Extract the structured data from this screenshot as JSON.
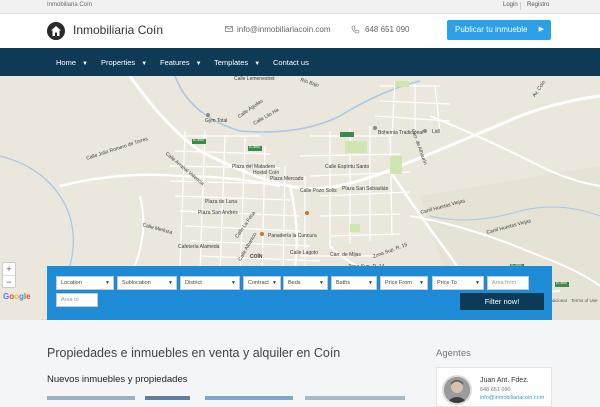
{
  "topbar": {
    "site_name": "Inmobiliaria Coín",
    "login": "Login",
    "register": "Registro"
  },
  "header": {
    "logo_text": "Inmobiliaria Coín",
    "logo_icon": "house-icon",
    "email": "info@inmobiliariacoin.com",
    "phone": "648 651 090",
    "publish_button": "Publicar tu inmueble",
    "accent": "#2b9fe8"
  },
  "nav": {
    "background": "#0e3a56",
    "items": [
      {
        "label": "Home",
        "dropdown": true
      },
      {
        "label": "Properties",
        "dropdown": true
      },
      {
        "label": "Features",
        "dropdown": true
      },
      {
        "label": "Templates",
        "dropdown": true
      },
      {
        "label": "Contact us",
        "dropdown": false
      }
    ]
  },
  "map": {
    "labels": [
      "Calle Lemenestret",
      "Río Bajo",
      "Calle Águilas",
      "Calle Lilo Ha",
      "Gym Total",
      "A-366",
      "A-366",
      "Calle Julio Romero de Torres",
      "Calle Arrabal Valencia",
      "Plaza del Matadero",
      "Hostal Coín",
      "Plaza Mercado",
      "Calle Espíritu Santo",
      "Calle Pozo Solís",
      "Plaza San Sebastián",
      "Bohemia Tradicional",
      "Lidl",
      "Carr. de Alhaurín",
      "Plaza de Luna",
      "Plaza San Andrés",
      "Calle Merluza",
      "Calle La Feria",
      "Calle Albanico",
      "Cafetería Alameda",
      "Panadería la Cuncura",
      "Carril Huertas Viejas",
      "Carril Huertas Viejas",
      "Carr. de Mijas",
      "Zona Sup. R. 15",
      "Calle Lagoto",
      "COÍN",
      "A-366",
      "A-366",
      "Zona Sup. R. 14",
      "Av. Coín"
    ],
    "zoom_in": "+",
    "zoom_out": "−",
    "google_logo": "Google",
    "attribution_1": "nacional",
    "attribution_2": "Terms of Use"
  },
  "search": {
    "selects": [
      {
        "label": "Location"
      },
      {
        "label": "Sublocation"
      },
      {
        "label": "District"
      },
      {
        "label": "Contract"
      },
      {
        "label": "Beds"
      },
      {
        "label": "Baths"
      },
      {
        "label": "Price From"
      },
      {
        "label": "Price To"
      }
    ],
    "area_from_placeholder": "Area from",
    "area_to_placeholder": "Area to",
    "filter_button": "Filter now!",
    "panel_color": "#1d8bd6"
  },
  "content": {
    "page_title": "Propiedades e inmuebles en venta y alquiler en Coín",
    "section_title": "Nuevos inmuebles y propiedades",
    "agents_title": "Agentes",
    "agent": {
      "name": "Juan Ant. Fdez.",
      "phone": "648 651 090",
      "email": "info@inmobiliariacoin.com"
    }
  }
}
